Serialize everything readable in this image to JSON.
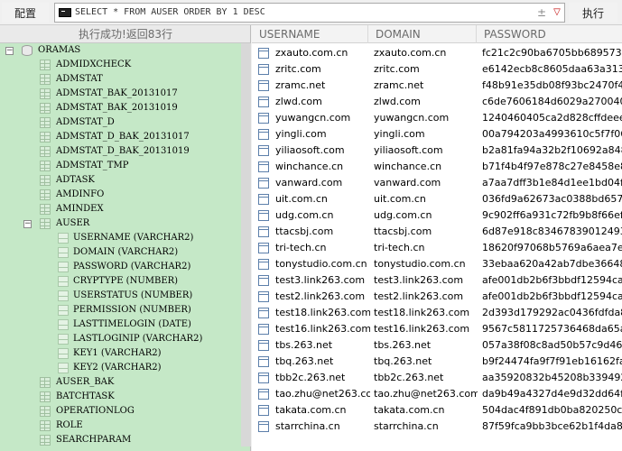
{
  "toolbar": {
    "config_label": "配置",
    "sql_text": "SELECT * FROM AUSER ORDER BY 1 DESC",
    "sql_plusminus": "±",
    "sql_dropdown": "▽",
    "execute_label": "执行"
  },
  "status": {
    "message": "执行成功!返回83行"
  },
  "tree": {
    "nodes": [
      {
        "level": 1,
        "type": "db",
        "expander": "−",
        "label": "ORAMAS"
      },
      {
        "level": 2,
        "type": "table",
        "label": "ADMIDXCHECK"
      },
      {
        "level": 2,
        "type": "table",
        "label": "ADMSTAT"
      },
      {
        "level": 2,
        "type": "table",
        "label": "ADMSTAT_BAK_20131017"
      },
      {
        "level": 2,
        "type": "table",
        "label": "ADMSTAT_BAK_20131019"
      },
      {
        "level": 2,
        "type": "table",
        "label": "ADMSTAT_D"
      },
      {
        "level": 2,
        "type": "table",
        "label": "ADMSTAT_D_BAK_20131017"
      },
      {
        "level": 2,
        "type": "table",
        "label": "ADMSTAT_D_BAK_20131019"
      },
      {
        "level": 2,
        "type": "table",
        "label": "ADMSTAT_TMP"
      },
      {
        "level": 2,
        "type": "table",
        "label": "ADTASK"
      },
      {
        "level": 2,
        "type": "table",
        "label": "AMDINFO"
      },
      {
        "level": 2,
        "type": "table",
        "label": "AMINDEX"
      },
      {
        "level": 2,
        "type": "table",
        "expander": "−",
        "label": "AUSER"
      },
      {
        "level": 3,
        "type": "column",
        "label": "USERNAME (VARCHAR2)"
      },
      {
        "level": 3,
        "type": "column",
        "label": "DOMAIN (VARCHAR2)"
      },
      {
        "level": 3,
        "type": "column",
        "label": "PASSWORD (VARCHAR2)"
      },
      {
        "level": 3,
        "type": "column",
        "label": "CRYPTYPE (NUMBER)"
      },
      {
        "level": 3,
        "type": "column",
        "label": "USERSTATUS (NUMBER)"
      },
      {
        "level": 3,
        "type": "column",
        "label": "PERMISSION (NUMBER)"
      },
      {
        "level": 3,
        "type": "column",
        "label": "LASTTIMELOGIN (DATE)"
      },
      {
        "level": 3,
        "type": "column",
        "label": "LASTLOGINIP (VARCHAR2)"
      },
      {
        "level": 3,
        "type": "column",
        "label": "KEY1 (VARCHAR2)"
      },
      {
        "level": 3,
        "type": "column",
        "label": "KEY2 (VARCHAR2)"
      },
      {
        "level": 2,
        "type": "table",
        "label": "AUSER_BAK"
      },
      {
        "level": 2,
        "type": "table",
        "label": "BATCHTASK"
      },
      {
        "level": 2,
        "type": "table",
        "label": "OPERATIONLOG"
      },
      {
        "level": 2,
        "type": "table",
        "label": "ROLE"
      },
      {
        "level": 2,
        "type": "table",
        "label": "SEARCHPARAM"
      }
    ]
  },
  "grid": {
    "columns": [
      "USERNAME",
      "DOMAIN",
      "PASSWORD"
    ],
    "rows": [
      [
        "zxauto.com.cn",
        "zxauto.com.cn",
        "fc21c2c90ba6705bb6895737"
      ],
      [
        "zritc.com",
        "zritc.com",
        "e6142ecb8c8605daa63a3132"
      ],
      [
        "zramc.net",
        "zramc.net",
        "f48b91e35db08f93bc2470f48"
      ],
      [
        "zlwd.com",
        "zlwd.com",
        "c6de7606184d6029a2700404"
      ],
      [
        "yuwangcn.com",
        "yuwangcn.com",
        "1240460405ca2d828cffdeee6"
      ],
      [
        "yingli.com",
        "yingli.com",
        "00a794203a4993610c5f7f067"
      ],
      [
        "yiliaosoft.com",
        "yiliaosoft.com",
        "b2a81fa94a32b2f10692a848"
      ],
      [
        "winchance.cn",
        "winchance.cn",
        "b71f4b4f97e878c27e8458e8"
      ],
      [
        "vanward.com",
        "vanward.com",
        "a7aa7dff3b1e84d1ee1bd04f4"
      ],
      [
        "uit.com.cn",
        "uit.com.cn",
        "036fd9a62673ac0388bd6579"
      ],
      [
        "udg.com.cn",
        "udg.com.cn",
        "9c902ff6a931c72fb9b8f66ef5"
      ],
      [
        "ttacsbj.com",
        "ttacsbj.com",
        "6d87e918c83467839012493"
      ],
      [
        "tri-tech.cn",
        "tri-tech.cn",
        "18620f97068b5769a6aea7ec"
      ],
      [
        "tonystudio.com.cn",
        "tonystudio.com.cn",
        "33ebaa620a42ab7dbe36648"
      ],
      [
        "test3.link263.com",
        "test3.link263.com",
        "afe001db2b6f3bbdf12594ca6"
      ],
      [
        "test2.link263.com",
        "test2.link263.com",
        "afe001db2b6f3bbdf12594ca6"
      ],
      [
        "test18.link263.com",
        "test18.link263.com",
        "2d393d179292ac0436fdfda8"
      ],
      [
        "test16.link263.com",
        "test16.link263.com",
        "9567c5811725736468da65a5"
      ],
      [
        "tbs.263.net",
        "tbs.263.net",
        "057a38f08c8ad50b57c9d46f"
      ],
      [
        "tbq.263.net",
        "tbq.263.net",
        "b9f24474fa9f7f91eb16162fa5"
      ],
      [
        "tbb2c.263.net",
        "tbb2c.263.net",
        "aa35920832b45208b339492b"
      ],
      [
        "tao.zhu@net263.com",
        "tao.zhu@net263.com",
        "da9b49a4327d4e9d32dd64f8"
      ],
      [
        "takata.com.cn",
        "takata.com.cn",
        "504dac4f891db0ba820250c9"
      ],
      [
        "starrchina.cn",
        "starrchina.cn",
        "87f59fca9bb3bce62b1f4da8"
      ]
    ]
  }
}
